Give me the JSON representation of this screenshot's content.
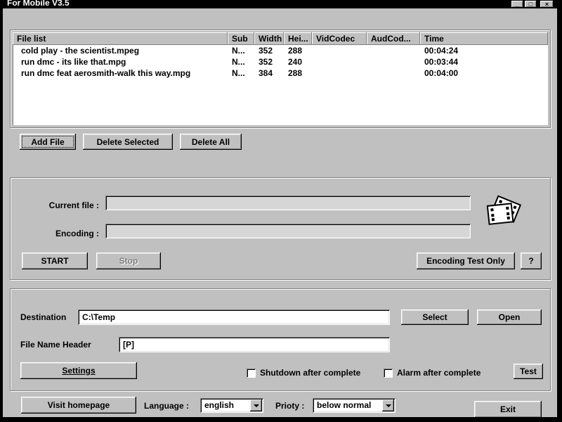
{
  "window": {
    "title": "For Mobile V3.5",
    "minimize_glyph": "_",
    "maximize_glyph": "□",
    "close_glyph": "×"
  },
  "file_list": {
    "columns": [
      "File list",
      "Sub",
      "Width",
      "Hei...",
      "VidCodec",
      "AudCod...",
      "Time"
    ],
    "rows": [
      {
        "name": "cold play - the scientist.mpeg",
        "sub": "N...",
        "width": "352",
        "height": "288",
        "vidcodec": "",
        "audcodec": "",
        "time": "00:04:24"
      },
      {
        "name": "run dmc - its like that.mpg",
        "sub": "N...",
        "width": "352",
        "height": "240",
        "vidcodec": "",
        "audcodec": "",
        "time": "00:03:44"
      },
      {
        "name": "run dmc feat aerosmith-walk this way.mpg",
        "sub": "N...",
        "width": "384",
        "height": "288",
        "vidcodec": "",
        "audcodec": "",
        "time": "00:04:00"
      }
    ]
  },
  "list_buttons": {
    "add_file": "Add File",
    "delete_selected": "Delete Selected",
    "delete_all": "Delete All"
  },
  "encoding_panel": {
    "current_file_label": "Current file :",
    "current_file_value": "",
    "encoding_label": "Encoding :",
    "encoding_value": "",
    "start_button": "START",
    "stop_button": "Stop",
    "encoding_test_button": "Encoding Test Only",
    "help_button": "?"
  },
  "output_panel": {
    "destination_label": "Destination",
    "destination_value": "C:\\Temp",
    "select_button": "Select",
    "open_button": "Open",
    "file_name_header_label": "File Name Header",
    "file_name_header_value": "[P]",
    "settings_button": "Settings",
    "shutdown_checkbox_label": "Shutdown after complete",
    "alarm_checkbox_label": "Alarm after complete",
    "test_button": "Test"
  },
  "footer": {
    "visit_homepage_button": "Visit homepage",
    "language_label": "Language :",
    "language_value": "english",
    "priority_label": "Prioty :",
    "priority_value": "below normal",
    "exit_button": "Exit"
  },
  "colors": {
    "window_face": "#c0c0c0",
    "titlebar": "#000000",
    "list_background": "#ffffff"
  }
}
